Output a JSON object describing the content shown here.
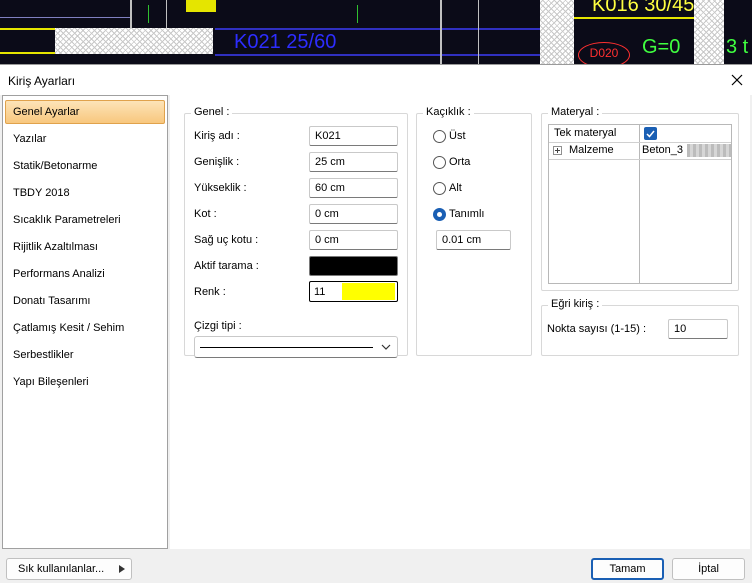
{
  "background": {
    "labels": [
      "K016 30/45",
      "K021 25/60",
      "D020",
      "G=0",
      "3 t"
    ]
  },
  "window": {
    "title": "Kiriş Ayarları",
    "close_icon": "close-icon"
  },
  "nav": {
    "items": [
      {
        "label": "Genel Ayarlar",
        "active": true
      },
      {
        "label": "Yazılar"
      },
      {
        "label": "Statik/Betonarme"
      },
      {
        "label": "TBDY 2018"
      },
      {
        "label": "Sıcaklık Parametreleri"
      },
      {
        "label": "Rijitlik Azaltılması"
      },
      {
        "label": "Performans Analizi"
      },
      {
        "label": "Donatı Tasarımı"
      },
      {
        "label": "Çatlamış Kesit / Sehim"
      },
      {
        "label": "Serbestlikler"
      },
      {
        "label": "Yapı Bileşenleri"
      }
    ]
  },
  "genel": {
    "title": "Genel :",
    "kiris_adi": {
      "label": "Kiriş adı :",
      "value": "K021"
    },
    "genislik": {
      "label": "Genişlik :",
      "value": "25 cm"
    },
    "yukseklik": {
      "label": "Yükseklik :",
      "value": "60 cm"
    },
    "kot": {
      "label": "Kot :",
      "value": "0 cm"
    },
    "sag_uc_kotu": {
      "label": "Sağ uç kotu :",
      "value": "0 cm"
    },
    "aktif_tarama": {
      "label": "Aktif tarama :",
      "color": "#000000"
    },
    "renk": {
      "label": "Renk :",
      "value": "11",
      "color": "#ffff00"
    },
    "cizgi_tipi": {
      "label": "Çizgi tipi :"
    }
  },
  "kaciklik": {
    "title": "Kaçıklık :",
    "options": [
      "Üst",
      "Orta",
      "Alt",
      "Tanımlı"
    ],
    "selected": "Tanımlı",
    "value": "0.01 cm"
  },
  "materyal": {
    "title": "Materyal :",
    "rows": [
      {
        "name": "Tek materyal",
        "checked": true
      },
      {
        "name": "Malzeme",
        "value": "Beton_3"
      }
    ]
  },
  "egri_kiris": {
    "title": "Eğri kiriş :",
    "nokta": {
      "label": "Nokta sayısı (1-15) :",
      "value": "10"
    }
  },
  "footer": {
    "favorites_label": "Sık kullanılanlar...",
    "ok_label": "Tamam",
    "cancel_label": "İptal"
  },
  "colors": {
    "accent": "#1a5fb4",
    "nav_active": "#f8c77e"
  }
}
